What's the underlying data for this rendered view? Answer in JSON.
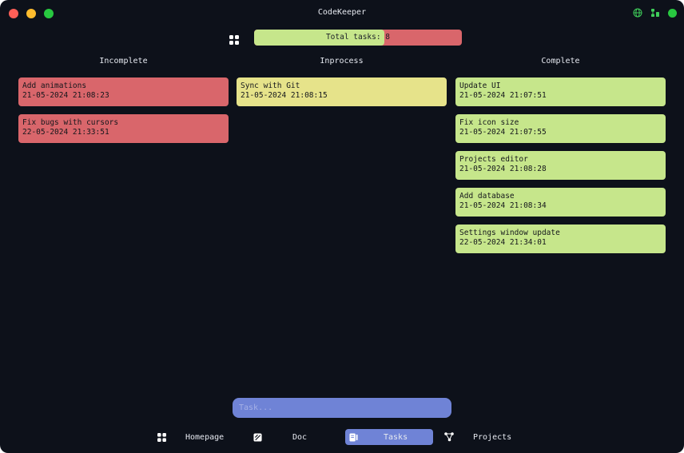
{
  "window": {
    "title": "CodeKeeper"
  },
  "header": {
    "progress_label": "Total tasks: 8",
    "progress_complete_fraction": 0.625
  },
  "columns": [
    {
      "title": "Incomplete",
      "color": "#d9666b",
      "tasks": [
        {
          "name": "Add animations",
          "time": "21-05-2024 21:08:23"
        },
        {
          "name": "Fix bugs with cursors",
          "time": "22-05-2024 21:33:51"
        }
      ]
    },
    {
      "title": "Inprocess",
      "color": "#e6e38a",
      "tasks": [
        {
          "name": "Sync with Git",
          "time": "21-05-2024 21:08:15"
        }
      ]
    },
    {
      "title": "Complete",
      "color": "#c6e68b",
      "tasks": [
        {
          "name": "Update UI",
          "time": "21-05-2024 21:07:51"
        },
        {
          "name": "Fix icon size",
          "time": "21-05-2024 21:07:55"
        },
        {
          "name": "Projects editor",
          "time": "21-05-2024 21:08:28"
        },
        {
          "name": "Add database",
          "time": "21-05-2024 21:08:34"
        },
        {
          "name": "Settings window update",
          "time": "22-05-2024 21:34:01"
        }
      ]
    }
  ],
  "task_input": {
    "placeholder": "Task..."
  },
  "nav": [
    {
      "label": "Homepage",
      "icon": "grid-icon"
    },
    {
      "label": "Doc",
      "icon": "doc-icon"
    },
    {
      "label": "Tasks",
      "icon": "tasks-icon",
      "active": true
    },
    {
      "label": "Projects",
      "icon": "graph-icon"
    }
  ],
  "colors": {
    "background": "#0d111a",
    "accent": "#6f83d6",
    "complete": "#c6e68b",
    "incomplete": "#d9666b",
    "inprocess": "#e6e38a"
  }
}
